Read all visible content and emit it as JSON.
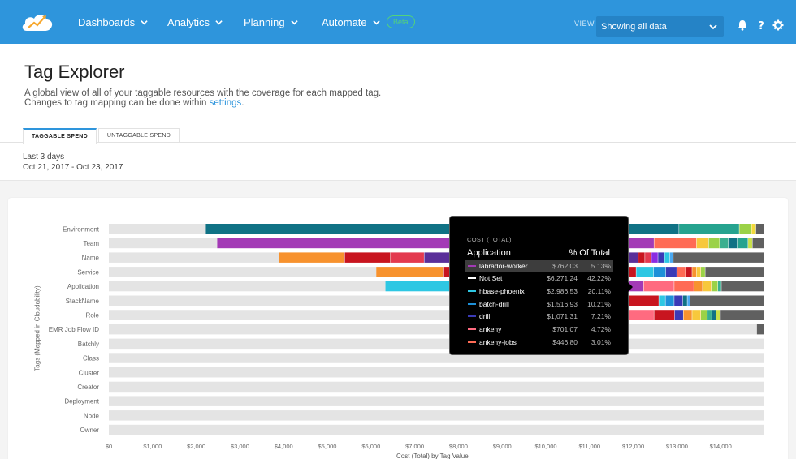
{
  "nav": {
    "items": [
      {
        "label": "Dashboards"
      },
      {
        "label": "Analytics"
      },
      {
        "label": "Planning"
      },
      {
        "label": "Automate"
      }
    ],
    "beta_label": "Beta",
    "view_label": "VIEW",
    "view_selected": "Showing all data",
    "bell_icon": "bell-icon",
    "help_icon": "help-icon",
    "gear_icon": "gear-icon"
  },
  "page": {
    "title": "Tag Explorer",
    "description_line1": "A global view of all of your taggable resources with the coverage for each mapped tag.",
    "description_line2_prefix": "Changes to tag mapping can be done within ",
    "description_link": "settings",
    "description_line2_suffix": "."
  },
  "tabs": [
    {
      "label": "TAGGABLE SPEND",
      "active": true
    },
    {
      "label": "UNTAGGABLE SPEND",
      "active": false
    }
  ],
  "range": {
    "label": "Last 3 days",
    "dates": "Oct 21, 2017 - Oct 23, 2017"
  },
  "chart_data": {
    "type": "bar",
    "orientation": "horizontal-stacked",
    "title": "",
    "xlabel": "Cost (Total) by Tag Value",
    "ylabel": "Tags (Mapped in Cloudability)",
    "xlim": [
      0,
      15000
    ],
    "x_ticks": [
      "$0",
      "$1,000",
      "$2,000",
      "$3,000",
      "$4,000",
      "$5,000",
      "$6,000",
      "$7,000",
      "$8,000",
      "$9,000",
      "$10,000",
      "$11,000",
      "$12,000",
      "$13,000",
      "$14,000"
    ],
    "categories": [
      "Environment",
      "Team",
      "Name",
      "Service",
      "Application",
      "StackName",
      "Role",
      "EMR Job Flow ID",
      "Batchly",
      "Class",
      "Cluster",
      "Creator",
      "Deployment",
      "Node",
      "Owner"
    ],
    "track_total": 15000,
    "rows": [
      {
        "tag": "Environment",
        "segments": [
          {
            "start": 0,
            "value": 2220,
            "color": "#e4e4e4"
          },
          {
            "start": 2220,
            "value": 10830,
            "color": "#107285"
          },
          {
            "start": 13050,
            "value": 1380,
            "color": "#26a38f"
          },
          {
            "start": 14430,
            "value": 280,
            "color": "#9bd247"
          },
          {
            "start": 14710,
            "value": 100,
            "color": "#f2d93b"
          },
          {
            "start": 14810,
            "value": 190,
            "color": "#606060"
          }
        ]
      },
      {
        "tag": "Team",
        "segments": [
          {
            "start": 0,
            "value": 2480,
            "color": "#e4e4e4"
          },
          {
            "start": 2480,
            "value": 10000,
            "color": "#a33ab6"
          },
          {
            "start": 12480,
            "value": 970,
            "color": "#ff6b55"
          },
          {
            "start": 13450,
            "value": 280,
            "color": "#f7c83c"
          },
          {
            "start": 13730,
            "value": 250,
            "color": "#9bd247"
          },
          {
            "start": 13980,
            "value": 200,
            "color": "#3aaf8f"
          },
          {
            "start": 14180,
            "value": 200,
            "color": "#107285"
          },
          {
            "start": 14380,
            "value": 250,
            "color": "#26a38f"
          },
          {
            "start": 14630,
            "value": 100,
            "color": "#c8e04a"
          },
          {
            "start": 14730,
            "value": 270,
            "color": "#606060"
          }
        ]
      },
      {
        "tag": "Name",
        "segments": [
          {
            "start": 0,
            "value": 3900,
            "color": "#e4e4e4"
          },
          {
            "start": 3900,
            "value": 1500,
            "color": "#f7922e"
          },
          {
            "start": 5400,
            "value": 1050,
            "color": "#c8151f"
          },
          {
            "start": 6450,
            "value": 770,
            "color": "#e33a4f"
          },
          {
            "start": 7220,
            "value": 4900,
            "color": "#5a2f99"
          },
          {
            "start": 12120,
            "value": 150,
            "color": "#c8151f"
          },
          {
            "start": 12270,
            "value": 150,
            "color": "#e33a4f"
          },
          {
            "start": 12420,
            "value": 150,
            "color": "#8a2be2"
          },
          {
            "start": 12570,
            "value": 150,
            "color": "#3a3ab6"
          },
          {
            "start": 12720,
            "value": 120,
            "color": "#2ec7e3"
          },
          {
            "start": 12840,
            "value": 80,
            "color": "#4aa8f0"
          },
          {
            "start": 12920,
            "value": 2080,
            "color": "#606060"
          }
        ]
      },
      {
        "tag": "Service",
        "segments": [
          {
            "start": 0,
            "value": 6120,
            "color": "#e4e4e4"
          },
          {
            "start": 6120,
            "value": 1550,
            "color": "#f7922e"
          },
          {
            "start": 7670,
            "value": 4400,
            "color": "#c8151f"
          },
          {
            "start": 12070,
            "value": 400,
            "color": "#2ec7e3"
          },
          {
            "start": 12470,
            "value": 280,
            "color": "#1e90d8"
          },
          {
            "start": 12750,
            "value": 250,
            "color": "#3a3ab6"
          },
          {
            "start": 13000,
            "value": 200,
            "color": "#ff6b55"
          },
          {
            "start": 13200,
            "value": 150,
            "color": "#c8151f"
          },
          {
            "start": 13350,
            "value": 100,
            "color": "#f7922e"
          },
          {
            "start": 13450,
            "value": 100,
            "color": "#f7c83c"
          },
          {
            "start": 13550,
            "value": 100,
            "color": "#9bd247"
          },
          {
            "start": 13650,
            "value": 1350,
            "color": "#606060"
          }
        ]
      },
      {
        "tag": "Application",
        "segments": [
          {
            "start": 0,
            "value": 6330,
            "color": "#e4e4e4"
          },
          {
            "start": 6330,
            "value": 5150,
            "color": "#2ec7e3"
          },
          {
            "start": 11480,
            "value": 760,
            "color": "#a33ab6"
          },
          {
            "start": 12240,
            "value": 700,
            "color": "#ff6b80"
          },
          {
            "start": 12940,
            "value": 450,
            "color": "#ff6b55"
          },
          {
            "start": 13390,
            "value": 200,
            "color": "#f7922e"
          },
          {
            "start": 13590,
            "value": 200,
            "color": "#f7c83c"
          },
          {
            "start": 13790,
            "value": 150,
            "color": "#9bd247"
          },
          {
            "start": 13940,
            "value": 80,
            "color": "#3aaf8f"
          },
          {
            "start": 14020,
            "value": 980,
            "color": "#606060"
          }
        ]
      },
      {
        "tag": "StackName",
        "segments": [
          {
            "start": 0,
            "value": 11800,
            "color": "#e4e4e4"
          },
          {
            "start": 11800,
            "value": 790,
            "color": "#c8151f"
          },
          {
            "start": 12590,
            "value": 150,
            "color": "#2ec7e3"
          },
          {
            "start": 12740,
            "value": 200,
            "color": "#1e90d8"
          },
          {
            "start": 12940,
            "value": 200,
            "color": "#3a3ab6"
          },
          {
            "start": 13140,
            "value": 100,
            "color": "#107285"
          },
          {
            "start": 13240,
            "value": 60,
            "color": "#4aa8f0"
          },
          {
            "start": 13300,
            "value": 1700,
            "color": "#606060"
          }
        ]
      },
      {
        "tag": "Role",
        "segments": [
          {
            "start": 0,
            "value": 11800,
            "color": "#e4e4e4"
          },
          {
            "start": 11800,
            "value": 680,
            "color": "#ff6b80"
          },
          {
            "start": 12480,
            "value": 470,
            "color": "#c8151f"
          },
          {
            "start": 12950,
            "value": 200,
            "color": "#3a3ab6"
          },
          {
            "start": 13150,
            "value": 200,
            "color": "#f7922e"
          },
          {
            "start": 13350,
            "value": 200,
            "color": "#f7c83c"
          },
          {
            "start": 13550,
            "value": 150,
            "color": "#9bd247"
          },
          {
            "start": 13700,
            "value": 100,
            "color": "#3aaf8f"
          },
          {
            "start": 13800,
            "value": 100,
            "color": "#107285"
          },
          {
            "start": 13900,
            "value": 100,
            "color": "#c8e04a"
          },
          {
            "start": 14000,
            "value": 1000,
            "color": "#606060"
          }
        ]
      },
      {
        "tag": "EMR Job Flow ID",
        "segments": [
          {
            "start": 0,
            "value": 14830,
            "color": "#e4e4e4"
          },
          {
            "start": 14830,
            "value": 170,
            "color": "#606060"
          }
        ]
      },
      {
        "tag": "Batchly",
        "segments": [
          {
            "start": 0,
            "value": 15000,
            "color": "#e4e4e4"
          }
        ]
      },
      {
        "tag": "Class",
        "segments": [
          {
            "start": 0,
            "value": 15000,
            "color": "#e4e4e4"
          }
        ]
      },
      {
        "tag": "Cluster",
        "segments": [
          {
            "start": 0,
            "value": 15000,
            "color": "#e4e4e4"
          }
        ]
      },
      {
        "tag": "Creator",
        "segments": [
          {
            "start": 0,
            "value": 15000,
            "color": "#e4e4e4"
          }
        ]
      },
      {
        "tag": "Deployment",
        "segments": [
          {
            "start": 0,
            "value": 15000,
            "color": "#e4e4e4"
          }
        ]
      },
      {
        "tag": "Node",
        "segments": [
          {
            "start": 0,
            "value": 15000,
            "color": "#e4e4e4"
          }
        ]
      },
      {
        "tag": "Owner",
        "segments": [
          {
            "start": 0,
            "value": 15000,
            "color": "#e4e4e4"
          }
        ]
      }
    ]
  },
  "tooltip": {
    "small_title": "COST (TOTAL)",
    "col_name": "Application",
    "col_pct": "% Of Total",
    "rows": [
      {
        "name": "labrador-worker",
        "cost": "$762.03",
        "pct": "5.13%",
        "color": "#a33ab6",
        "highlight": true
      },
      {
        "name": "Not Set",
        "cost": "$6,271.24",
        "pct": "42.22%",
        "color": "#ffffff",
        "highlight": false
      },
      {
        "name": "hbase-phoenix",
        "cost": "$2,986.53",
        "pct": "20.11%",
        "color": "#2ec7e3",
        "highlight": false
      },
      {
        "name": "batch-drill",
        "cost": "$1,516.93",
        "pct": "10.21%",
        "color": "#1e90d8",
        "highlight": false
      },
      {
        "name": "drill",
        "cost": "$1,071.31",
        "pct": "7.21%",
        "color": "#3a3ab6",
        "highlight": false
      },
      {
        "name": "ankeny",
        "cost": "$701.07",
        "pct": "4.72%",
        "color": "#ff6b80",
        "highlight": false
      },
      {
        "name": "ankeny-jobs",
        "cost": "$446.80",
        "pct": "3.01%",
        "color": "#ff6b55",
        "highlight": false
      }
    ]
  },
  "colors": {
    "nav_bg": "#2e95dc",
    "accent": "#2e95dc",
    "beta": "#52d27c"
  }
}
